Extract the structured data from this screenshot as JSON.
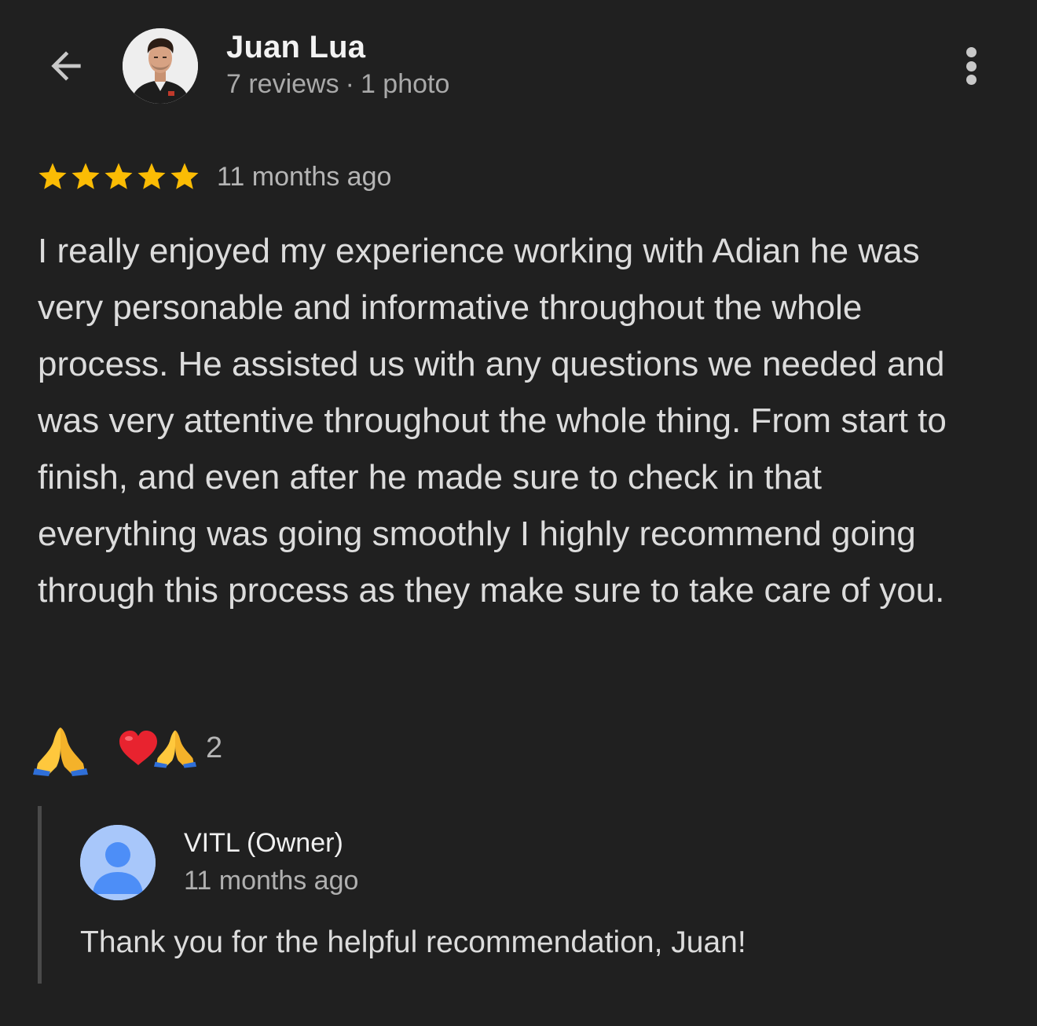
{
  "header": {
    "reviewer_name": "Juan Lua",
    "reviews_count": "7 reviews",
    "separator": "·",
    "photos_count": "1 photo",
    "icons": {
      "back": "arrow-left-icon",
      "more": "more-vert-icon",
      "avatar": "profile-photo"
    }
  },
  "review": {
    "rating": 5,
    "max_rating": 5,
    "star_color": "#fbbc04",
    "time": "11 months ago",
    "text": "I really enjoyed my experience working with Adian he was very personable and informative throughout the whole process. He assisted us with any questions we needed and was very attentive throughout the whole thing. From start to finish, and even after he made sure to check in that everything was going smoothly I highly recommend going through this process as they make sure to take care of you."
  },
  "reactions": {
    "like_icon": "folded-hands-icon",
    "summary_icons": [
      "heart-icon",
      "folded-hands-icon"
    ],
    "count": "2"
  },
  "owner_reply": {
    "name": "VITL (Owner)",
    "time": "11 months ago",
    "text": "Thank you for the helpful recommendation, Juan!",
    "avatar_icon": "person-icon",
    "avatar_color": "#a8c7fa",
    "avatar_figure_color": "#4d8ef7"
  }
}
